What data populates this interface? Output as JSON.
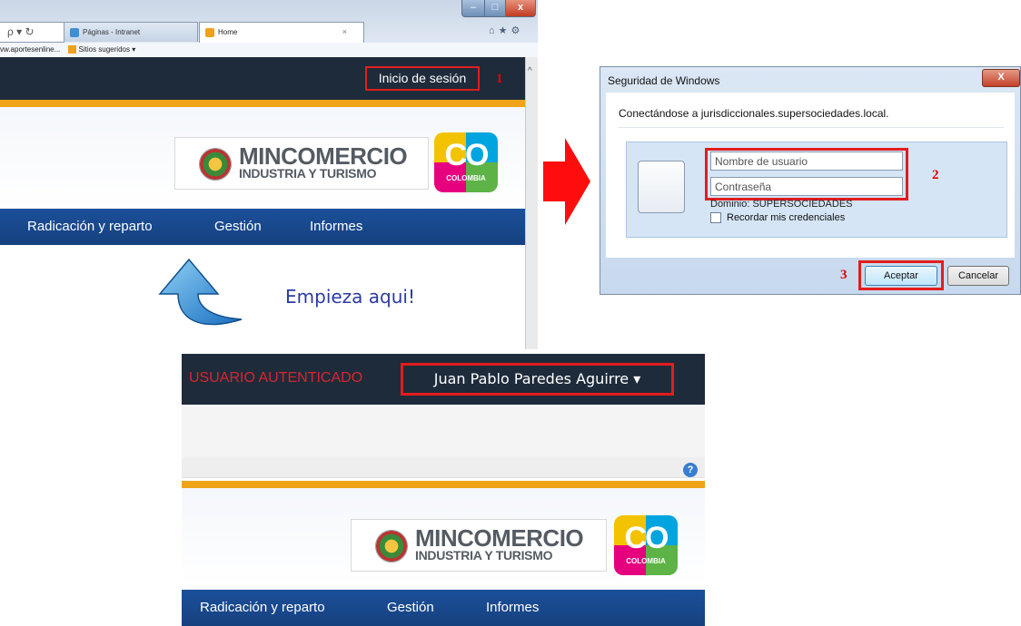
{
  "browser": {
    "address_fragment": "ρ ▾ ↻",
    "tab_inactive": "Páginas - Intranet",
    "tab_active": "Home",
    "tab_close": "×",
    "favorites_site": "vw.aportesenline...",
    "favorites_suggested": "Sitios sugeridos ▾",
    "caption_min": "–",
    "caption_max": "□",
    "caption_close": "x",
    "right_icons": "⌂★⚙"
  },
  "site": {
    "login_link": "Inicio de sesión",
    "logo_title": "MINCOMERCIO",
    "logo_subtitle": "INDUSTRIA Y TURISMO",
    "co_logo": "CO",
    "co_logo_sub": "COLOMBIA",
    "nav": [
      "Radicación y reparto",
      "Gestión",
      "Informes"
    ],
    "start_here": "Empieza aqui!"
  },
  "annotations": {
    "step1": "1",
    "step2": "2",
    "step3": "3"
  },
  "dialog": {
    "title": "Seguridad de Windows",
    "close": "X",
    "message": "Conectándose a jurisdiccionales.supersociedades.local.",
    "username_placeholder": "Nombre de usuario",
    "password_placeholder": "Contraseña",
    "domain": "Dominio: SUPERSOCIEDADES",
    "remember": "Recordar mis credenciales",
    "accept": "Aceptar",
    "cancel": "Cancelar"
  },
  "auth": {
    "status_label": "USUARIO AUTENTICADO",
    "user_name": "Juan Pablo Paredes Aguirre ▾",
    "help": "?"
  },
  "colors": {
    "annotation_red": "#e21d1d",
    "top_bar": "#1e2b3b",
    "nav_blue": "#1b4f9a",
    "accent_orange": "#f0a41a"
  }
}
